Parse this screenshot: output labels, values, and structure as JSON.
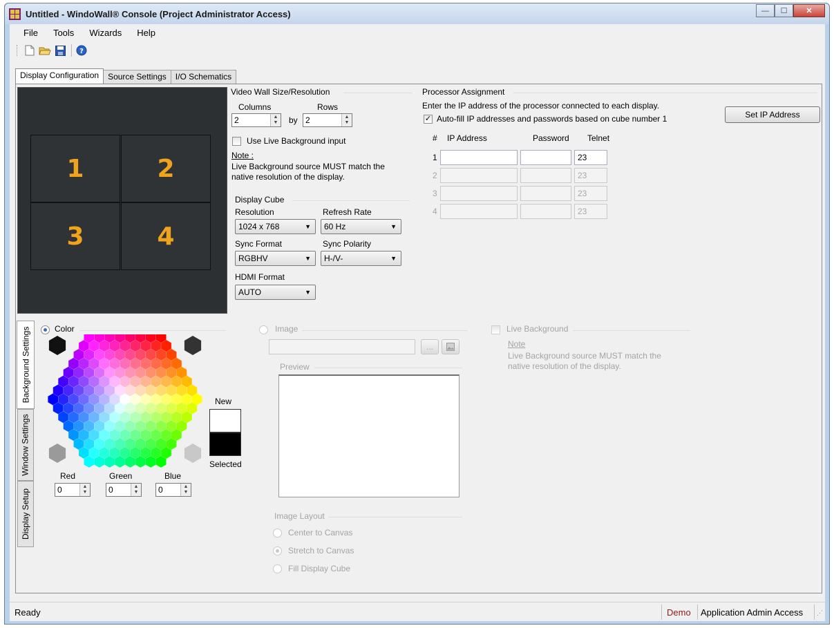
{
  "window": {
    "title": "Untitled - WindoWall® Console (Project Administrator Access)",
    "minimize": "—",
    "maximize": "☐",
    "close": "✕"
  },
  "menu": [
    "File",
    "Tools",
    "Wizards",
    "Help"
  ],
  "toolbar": [
    "new-icon",
    "open-icon",
    "save-icon",
    "help-icon"
  ],
  "tabs": [
    "Display Configuration",
    "Source Settings",
    "I/O Schematics"
  ],
  "cubes": [
    "1",
    "2",
    "3",
    "4"
  ],
  "wall": {
    "title": "Video Wall Size/Resolution",
    "columns_label": "Columns",
    "rows_label": "Rows",
    "columns": "2",
    "by": "by",
    "rows": "2",
    "live_bg": "Use Live Background input",
    "note_title": "Note :",
    "note_line1": "Live Background source MUST match the",
    "note_line2": "native resolution of the display.",
    "cube_title": "Display Cube",
    "resolution_label": "Resolution",
    "resolution": "1024 x 768",
    "refresh_label": "Refresh Rate",
    "refresh": "60 Hz",
    "sync_format_label": "Sync Format",
    "sync_format": "RGBHV",
    "sync_polarity_label": "Sync Polarity",
    "sync_polarity": "H-/V-",
    "hdmi_label": "HDMI Format",
    "hdmi": "AUTO"
  },
  "processor": {
    "title": "Processor Assignment",
    "instructions": "Enter the IP address of the processor connected to each display.",
    "autofill": "Auto-fill IP addresses and passwords based on cube number 1",
    "set_ip_button": "Set IP Address",
    "col_num": "#",
    "col_ip": "IP Address",
    "col_password": "Password",
    "col_telnet": "Telnet",
    "rows": [
      {
        "num": "1",
        "ip": "",
        "password": "",
        "telnet": "23"
      },
      {
        "num": "2",
        "ip": "",
        "password": "",
        "telnet": "23"
      },
      {
        "num": "3",
        "ip": "",
        "password": "",
        "telnet": "23"
      },
      {
        "num": "4",
        "ip": "",
        "password": "",
        "telnet": "23"
      }
    ]
  },
  "side_tabs": [
    "Background Settings",
    "Window Settings",
    "Display Setup"
  ],
  "background": {
    "color_label": "Color",
    "new_label": "New",
    "selected_label": "Selected",
    "red_label": "Red",
    "green_label": "Green",
    "blue_label": "Blue",
    "red": "0",
    "green": "0",
    "blue": "0",
    "new_color": "#ffffff",
    "selected_color": "#000000",
    "image_label": "Image",
    "browse": "...",
    "preview_label": "Preview",
    "layout_label": "Image Layout",
    "layout_options": [
      "Center to Canvas",
      "Stretch to Canvas",
      "Fill Display Cube"
    ],
    "live_label": "Live Background",
    "live_note_title": "Note",
    "live_note_line1": "Live Background source MUST match the",
    "live_note_line2": "native resolution of the display."
  },
  "status": {
    "left": "Ready",
    "demo": "Demo",
    "access": "Application Admin Access"
  }
}
